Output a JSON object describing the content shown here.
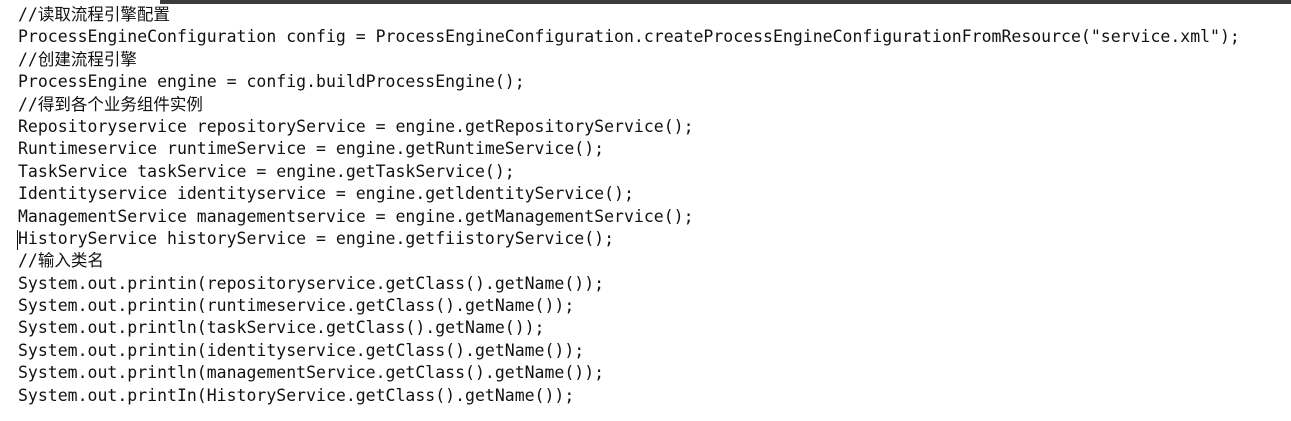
{
  "editor": {
    "lines": [
      "//读取流程引擎配置",
      "ProcessEngineConfiguration config = ProcessEngineConfiguration.createProcessEngineConfigurationFromResource(\"service.xml\");",
      "//创建流程引擎",
      "ProcessEngine engine = config.buildProcessEngine();",
      "//得到各个业务组件实例",
      "Repositoryservice repositoryService = engine.getRepositoryService();",
      "Runtimeservice runtimeService = engine.getRuntimeService();",
      "TaskService taskService = engine.getTaskService();",
      "Identityservice identityservice = engine.getldentityService();",
      "ManagementService managementservice = engine.getManagementService();",
      "HistoryService historyService = engine.getfiistoryService();",
      "//输入类名",
      "System.out.printin(repositoryservice.getClass().getName());",
      "System.out.printin(runtimeservice.getClass().getName());",
      "System.out.println(taskService.getClass().getName());",
      "System.out.printin(identityservice.getClass().getName());",
      "System.out.println(managementService.getClass().getName());",
      "System.out.printIn(HistoryService.getClass().getName());"
    ]
  }
}
